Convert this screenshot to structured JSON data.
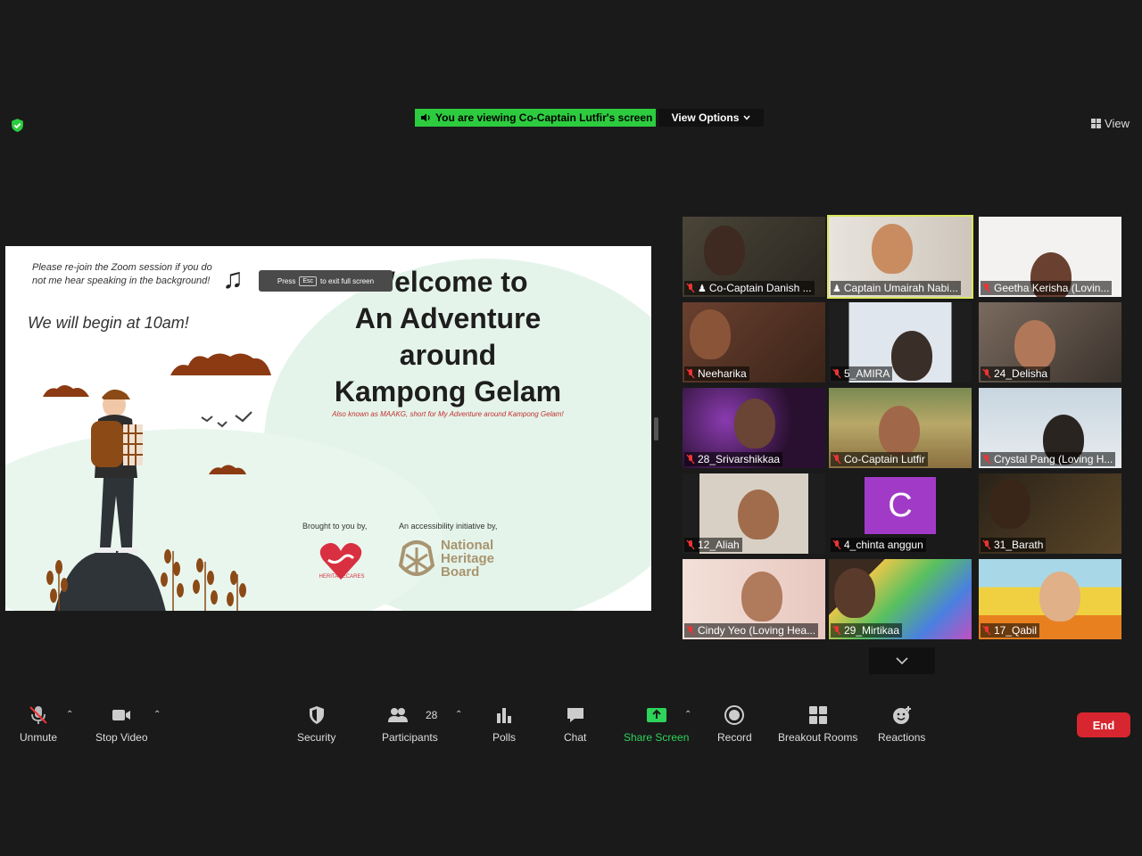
{
  "banner": {
    "viewing_text": "You are viewing Co-Captain Lutfir's screen",
    "view_options_label": "View Options",
    "view_label": "View"
  },
  "slide": {
    "rejoin_note": "Please re-join the Zoom session if you do not me hear speaking in the background!",
    "begin_note": "We will begin at 10am!",
    "esc_tip_press": "Press",
    "esc_tip_key": "Esc",
    "esc_tip_rest": "to exit full screen",
    "title_lines": [
      "Welcome to",
      "An Adventure",
      "around",
      "Kampong Gelam"
    ],
    "subtitle": "Also known as MAAKG, short for My Adventure around Kampong Gelam!",
    "brought_by": "Brought to you by,",
    "initiative_by": "An accessibility initiative by,",
    "heritagecares": "HERITAGECARES",
    "nhb_lines": [
      "National",
      "Heritage",
      "Board"
    ]
  },
  "gallery": {
    "participants": [
      "Co-Captain Danish ...",
      "Captain Umairah Nabi...",
      "Geetha Kerisha (Lovin...",
      "Neeharika",
      "5_AMIRA",
      "24_Delisha",
      "28_Srivarshikkaa",
      "Co-Captain Lutfir",
      "Crystal Pang (Loving H...",
      "12_Aliah",
      "4_chinta anggun",
      "31_Barath",
      "Cindy Yeo (Loving Hea...",
      "29_Mirtikaa",
      "17_Qabil"
    ],
    "avatar_letter": "C"
  },
  "toolbar": {
    "unmute": "Unmute",
    "stop_video": "Stop Video",
    "security": "Security",
    "participants": "Participants",
    "participant_count": "28",
    "polls": "Polls",
    "chat": "Chat",
    "share_screen": "Share Screen",
    "record": "Record",
    "breakout_rooms": "Breakout Rooms",
    "reactions": "Reactions",
    "end": "End"
  },
  "colors": {
    "banner_green": "#2dcc3f",
    "share_green": "#2dd35a",
    "end_red": "#d7262f",
    "active_speaker": "#d9e75c",
    "avatar_purple": "#a13bc7"
  }
}
